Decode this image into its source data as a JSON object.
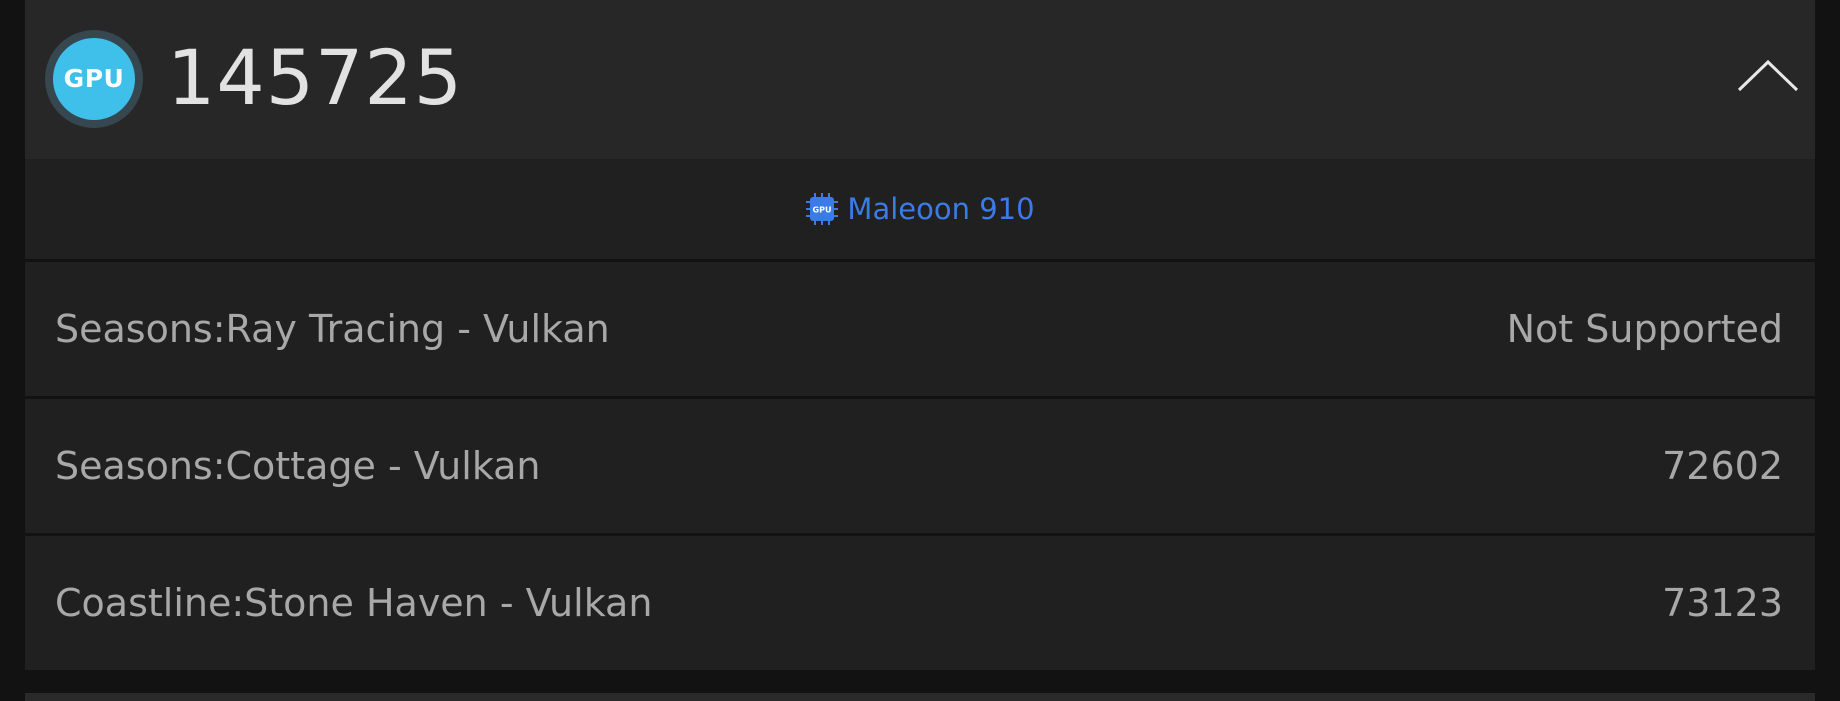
{
  "gpu_section": {
    "badge_label": "GPU",
    "total_score": "145725",
    "collapse_icon": "chevron-up-icon",
    "device": {
      "icon": "gpu-chip-icon",
      "chip_label": "GPU",
      "name": "Maleoon 910"
    },
    "results": [
      {
        "label": "Seasons:Ray Tracing - Vulkan",
        "value": "Not Supported"
      },
      {
        "label": "Seasons:Cottage - Vulkan",
        "value": "72602"
      },
      {
        "label": "Coastline:Stone Haven - Vulkan",
        "value": "73123"
      }
    ]
  },
  "colors": {
    "background": "#121212",
    "header_bg": "#272727",
    "row_bg": "#202020",
    "badge_fill": "#3fc0ea",
    "device_link": "#3a7be6",
    "score_text": "#e2e2e2",
    "row_text": "#a8a8a8"
  }
}
